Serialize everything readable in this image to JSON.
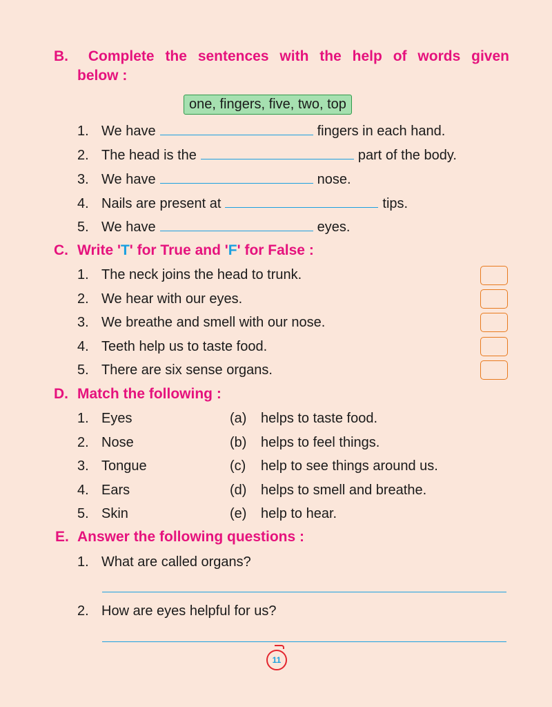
{
  "sectionB": {
    "letter": "B.",
    "headingWords": [
      "Complete",
      "the",
      "sentences",
      "with",
      "the",
      "help",
      "of",
      "words",
      "given"
    ],
    "headingLine2": "below :",
    "wordBox": "one, fingers, five, two, top",
    "items": [
      {
        "num": "1.",
        "before": "We have",
        "after": "fingers in each hand."
      },
      {
        "num": "2.",
        "before": "The head is the",
        "after": "part of the body."
      },
      {
        "num": "3.",
        "before": "We have",
        "after": "nose."
      },
      {
        "num": "4.",
        "before": "Nails are present at",
        "after": "tips."
      },
      {
        "num": "5.",
        "before": "We have",
        "after": "eyes."
      }
    ]
  },
  "sectionC": {
    "letter": "C.",
    "headingPre": "Write '",
    "headingT": "T",
    "headingMid": "' for True and '",
    "headingF": "F",
    "headingPost": "' for False :",
    "items": [
      {
        "num": "1.",
        "text": "The neck joins the head to trunk."
      },
      {
        "num": "2.",
        "text": "We hear with our eyes."
      },
      {
        "num": "3.",
        "text": "We breathe and smell with our nose."
      },
      {
        "num": "4.",
        "text": "Teeth help us to taste food."
      },
      {
        "num": "5.",
        "text": "There are six sense organs."
      }
    ]
  },
  "sectionD": {
    "letter": "D.",
    "heading": "Match the following :",
    "items": [
      {
        "num": "1.",
        "left": "Eyes",
        "label": "(a)",
        "right": "helps to taste food."
      },
      {
        "num": "2.",
        "left": "Nose",
        "label": "(b)",
        "right": "helps to feel things."
      },
      {
        "num": "3.",
        "left": "Tongue",
        "label": "(c)",
        "right": "help to see things around us."
      },
      {
        "num": "4.",
        "left": "Ears",
        "label": "(d)",
        "right": "helps to smell and breathe."
      },
      {
        "num": "5.",
        "left": "Skin",
        "label": "(e)",
        "right": "help to hear."
      }
    ]
  },
  "sectionE": {
    "letter": "E.",
    "heading": "Answer the following questions :",
    "items": [
      {
        "num": "1.",
        "text": "What are called organs?"
      },
      {
        "num": "2.",
        "text": "How are eyes helpful for us?"
      }
    ]
  },
  "pageNumber": "11",
  "colors": {
    "heading": "#e5127d",
    "accent": "#1aa0e0",
    "box": "#e87a1e",
    "background": "#fbe6da"
  }
}
